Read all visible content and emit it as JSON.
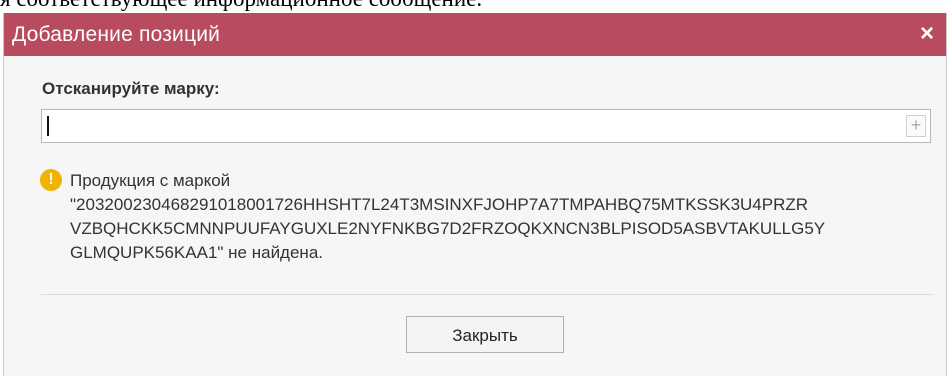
{
  "background_text": "я соответствующее информационное сообщение.",
  "dialog": {
    "title": "Добавление позиций",
    "close_glyph": "×",
    "scan_label": "Отсканируйте марку:",
    "scan_input_value": "",
    "add_glyph": "+",
    "warning_icon": "warning-icon",
    "warning_glyph": "!",
    "message_lines": [
      "Продукция с маркой",
      "\"203200230468291018001726HHSHT7L24T3MSINXFJOHP7A7TMPAHBQ75MTKSSK3U4PRZR",
      "VZBQHCKK5CMNNPUUFAYGUXLE2NYFNKBG7D2FRZOQKXNCN3BLPISOD5ASBVTAKULLG5Y",
      "GLMQUPK56KAA1\" не найдена."
    ],
    "close_button_label": "Закрыть"
  },
  "colors": {
    "titlebar": "#b84c5e",
    "warning": "#f2b200"
  }
}
